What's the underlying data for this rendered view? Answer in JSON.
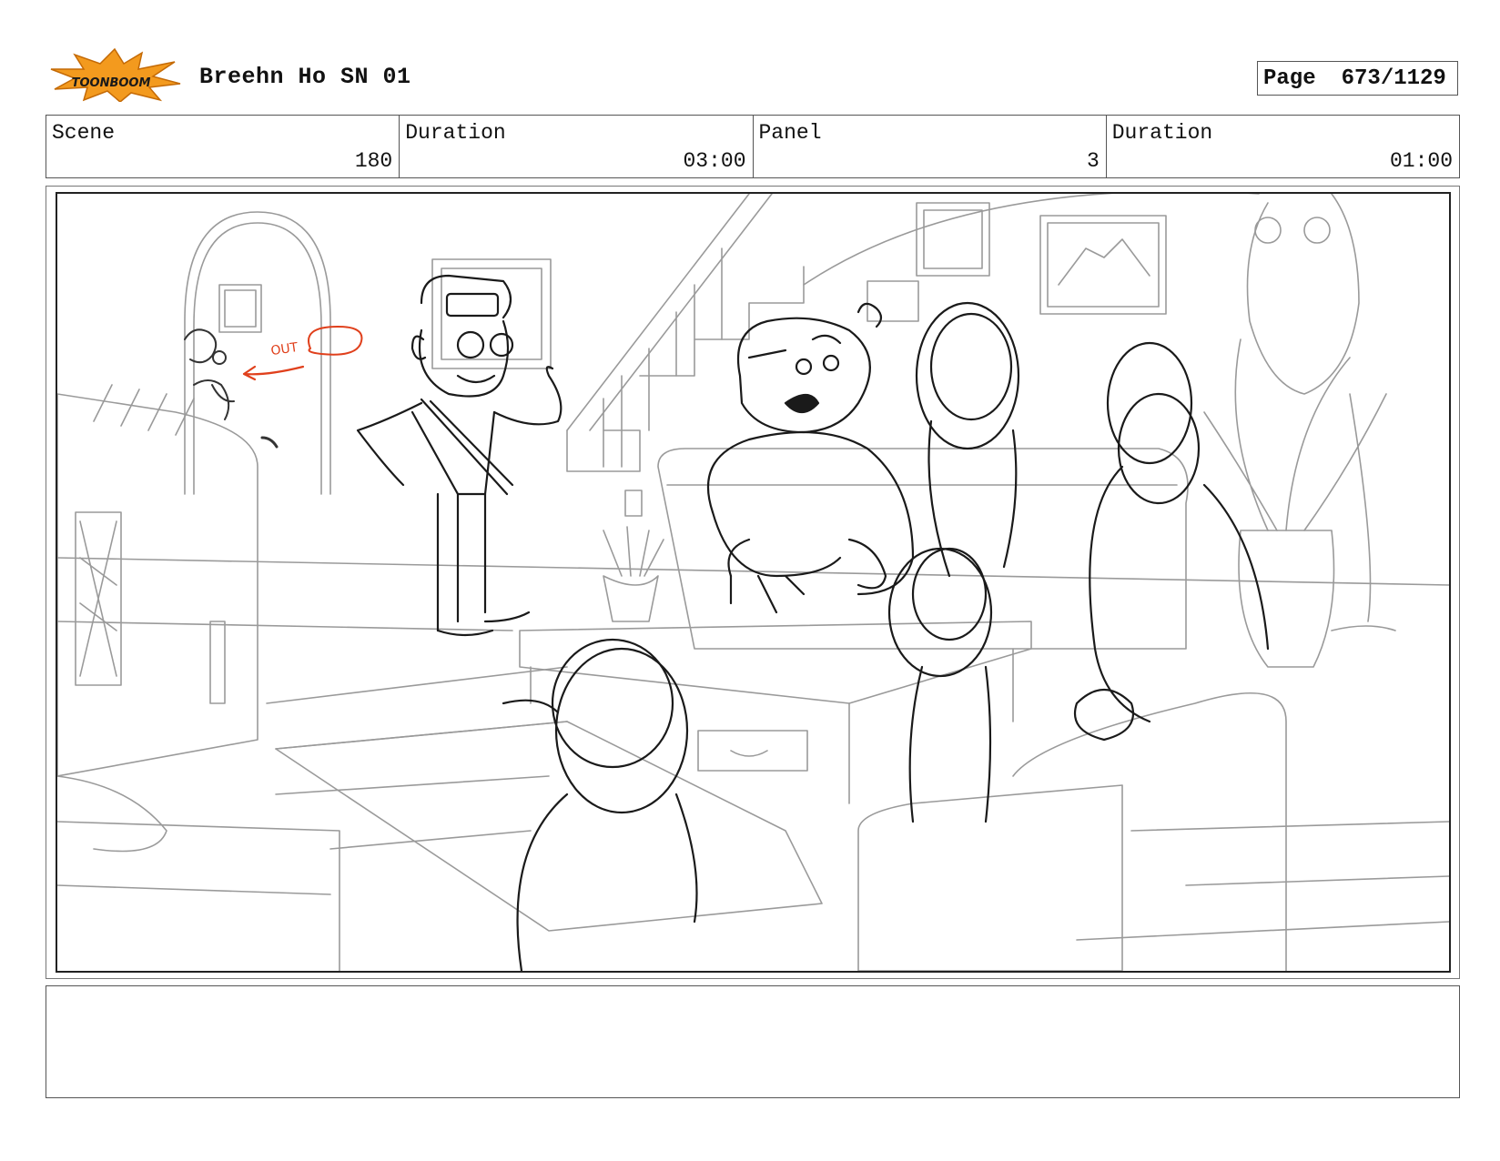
{
  "header": {
    "logo": {
      "icon": "toon-boom-logo",
      "text": "TOONBOOM",
      "colors": {
        "burst": "#f39a1e",
        "text": "#1a1a1a"
      }
    },
    "project_title": "Breehn Ho SN 01",
    "page_label": "Page",
    "page_value": "673/1129"
  },
  "info": {
    "scene_label": "Scene",
    "scene_value": "180",
    "duration_label": "Duration",
    "duration_value": "03:00",
    "panel_label": "Panel",
    "panel_value": "3",
    "panel_duration_label": "Duration",
    "panel_duration_value": "01:00"
  },
  "panel": {
    "annotation": "OUT",
    "annotation_color": "#e0401c"
  },
  "notes": {
    "text": ""
  }
}
